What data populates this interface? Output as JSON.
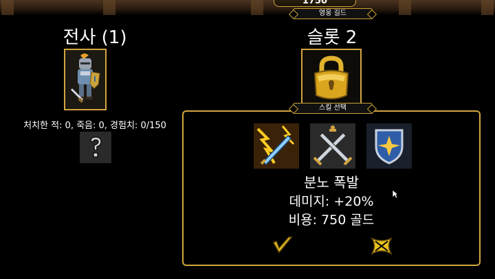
{
  "header": {
    "gold_counter": "1750",
    "guild_banner": "영웅 길드"
  },
  "hero": {
    "title": "전사 (1)",
    "stats": "처치한 적: 0, 죽음: 0, 경험치: 0/150",
    "unknown_slot": "?"
  },
  "slot": {
    "title": "슬롯 2"
  },
  "skill_panel": {
    "banner": "스킬 선택",
    "skills": [
      {
        "icon": "rage-burst-sword-icon"
      },
      {
        "icon": "crossed-swords-icon"
      },
      {
        "icon": "shield-star-icon"
      }
    ],
    "selected": {
      "name": "분노 폭발",
      "effect": "데미지: +20%",
      "cost": "비용: 750 골드"
    },
    "confirm_icon": "checkmark-icon",
    "cancel_icon": "cross-icon"
  },
  "colors": {
    "gold_border": "#d4a640",
    "background": "#000000",
    "text": "#ffffff"
  }
}
